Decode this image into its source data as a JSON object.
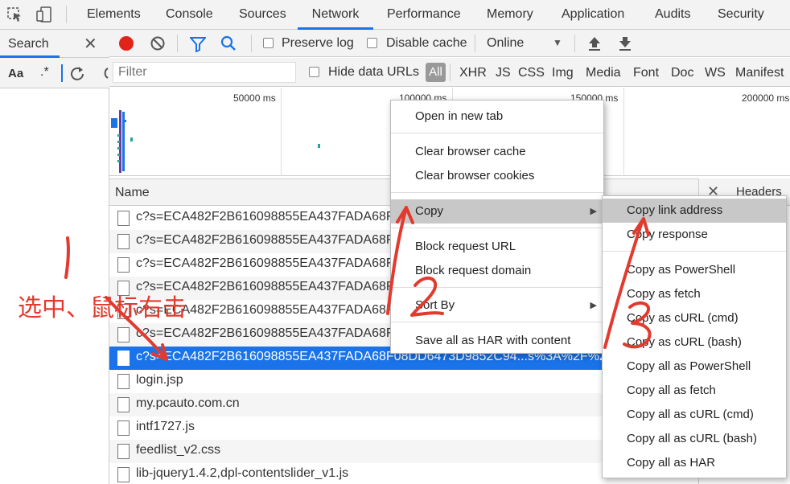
{
  "devtools_tabs": [
    "Elements",
    "Console",
    "Sources",
    "Network",
    "Performance",
    "Memory",
    "Application",
    "Audits",
    "Security"
  ],
  "active_tab": "Network",
  "search_panel": {
    "title": "Search",
    "case_label": "Aa",
    "regex_label": ".*"
  },
  "toolbar": {
    "preserve_log": "Preserve log",
    "disable_cache": "Disable cache",
    "throttling": "Online"
  },
  "filter_bar": {
    "placeholder": "Filter",
    "hide_data_urls": "Hide data URLs",
    "types": [
      "All",
      "XHR",
      "JS",
      "CSS",
      "Img",
      "Media",
      "Font",
      "Doc",
      "WS",
      "Manifest"
    ]
  },
  "overview": {
    "ticks": [
      "50000 ms",
      "100000 ms",
      "150000 ms",
      "200000 ms"
    ]
  },
  "table": {
    "name_header": "Name",
    "rows": [
      "c?s=ECA482F2B616098855EA437FADA68F0",
      "c?s=ECA482F2B616098855EA437FADA68F0",
      "c?s=ECA482F2B616098855EA437FADA68F0",
      "c?s=ECA482F2B616098855EA437FADA68F0",
      "c?s=ECA482F2B616098855EA437FADA68F0",
      "c?s=ECA482F2B616098855EA437FADA68F0",
      "c?s=ECA482F2B616098855EA437FADA68F08DD6473D9852C94...s%3A%2F%2F",
      "login.jsp",
      "my.pcauto.com.cn",
      "intf1727.js",
      "feedlist_v2.css",
      "lib-jquery1.4.2,dpl-contentslider_v1.js"
    ],
    "selected_index": 6
  },
  "details_panel": {
    "label": "Headers"
  },
  "context_menu": {
    "items": [
      "Open in new tab",
      "Clear browser cache",
      "Clear browser cookies",
      "Copy",
      "Block request URL",
      "Block request domain",
      "Sort By",
      "Save all as HAR with content"
    ]
  },
  "copy_submenu": {
    "items": [
      "Copy link address",
      "Copy response",
      "Copy as PowerShell",
      "Copy as fetch",
      "Copy as cURL (cmd)",
      "Copy as cURL (bash)",
      "Copy all as PowerShell",
      "Copy all as fetch",
      "Copy all as cURL (cmd)",
      "Copy all as cURL (bash)",
      "Copy all as HAR"
    ]
  },
  "annotations": {
    "step1_note": "选中、鼠标右击"
  },
  "colors": {
    "accent": "#1a73e8",
    "record": "#e2231a",
    "annotation": "#e23a2e"
  }
}
